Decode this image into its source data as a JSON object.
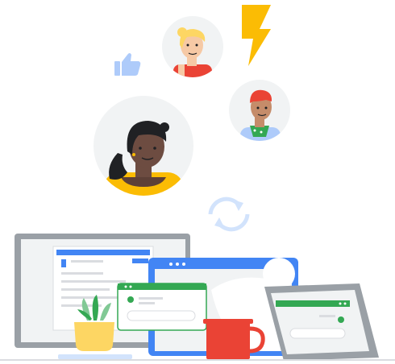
{
  "illustration": {
    "palette": {
      "blue": "#4285f4",
      "light_blue": "#aecbfa",
      "yellow": "#fbbc04",
      "red": "#ea4335",
      "green": "#34a853",
      "grey_light": "#f1f3f4",
      "grey_mid": "#dadce0",
      "grey_dark": "#9aa0a6"
    },
    "elements": [
      "avatar-woman-large",
      "avatar-woman-blonde",
      "avatar-man-redhair",
      "lightning-bolt-icon",
      "thumbs-up-icon",
      "sync-icon",
      "desktop-monitor",
      "laptop",
      "tablet",
      "popup-card",
      "potted-plant",
      "coffee-mug"
    ]
  }
}
